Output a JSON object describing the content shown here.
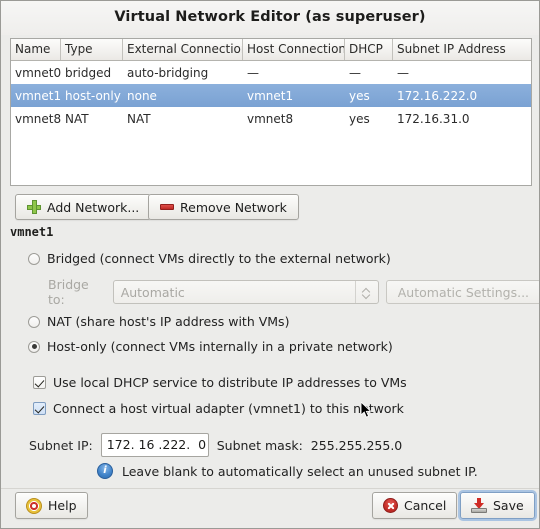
{
  "window": {
    "title": "Virtual Network Editor (as superuser)"
  },
  "table": {
    "columns": [
      "Name",
      "Type",
      "External Connection",
      "Host Connection",
      "DHCP",
      "Subnet IP Address"
    ],
    "rows": [
      {
        "name": "vmnet0",
        "type": "bridged",
        "external_connection": "auto-bridging",
        "host_connection": "—",
        "dhcp": "—",
        "subnet_ip": "—",
        "selected": false
      },
      {
        "name": "vmnet1",
        "type": "host-only",
        "external_connection": "none",
        "host_connection": "vmnet1",
        "dhcp": "yes",
        "subnet_ip": "172.16.222.0",
        "selected": true
      },
      {
        "name": "vmnet8",
        "type": "NAT",
        "external_connection": "NAT",
        "host_connection": "vmnet8",
        "dhcp": "yes",
        "subnet_ip": "172.16.31.0",
        "selected": false
      }
    ],
    "selection_color": "#7aa2d3"
  },
  "toolbar": {
    "add_label": "Add Network...",
    "remove_label": "Remove Network",
    "add_icon": "plus-icon",
    "remove_icon": "minus-icon"
  },
  "details": {
    "section_label": "vmnet1",
    "options": [
      {
        "label": "Bridged (connect VMs directly to the external network)",
        "checked": false
      },
      {
        "label": "NAT (share host's IP address with VMs)",
        "checked": false
      },
      {
        "label": "Host-only (connect VMs internally in a private network)",
        "checked": true
      }
    ],
    "bridge": {
      "label": "Bridge to:",
      "value": "Automatic",
      "settings_label": "Automatic Settings...",
      "disabled": true
    },
    "checkboxes": [
      {
        "label": "Use local DHCP service to distribute IP addresses to VMs",
        "checked": true,
        "highlighted": false
      },
      {
        "label": "Connect a host virtual adapter (vmnet1) to this network",
        "checked": true,
        "highlighted": true
      }
    ],
    "subnet": {
      "ip_label": "Subnet IP:",
      "ip_value": "172. 16 .222.  0",
      "mask_label": "Subnet mask:",
      "mask_value": "255.255.255.0"
    },
    "hint": {
      "icon": "info-icon",
      "text": "Leave blank to automatically select an unused subnet IP."
    }
  },
  "footer": {
    "help_label": "Help",
    "cancel_label": "Cancel",
    "save_label": "Save",
    "help_icon": "lifebuoy-icon",
    "cancel_icon": "close-circle-icon",
    "save_icon": "save-arrow-icon"
  }
}
